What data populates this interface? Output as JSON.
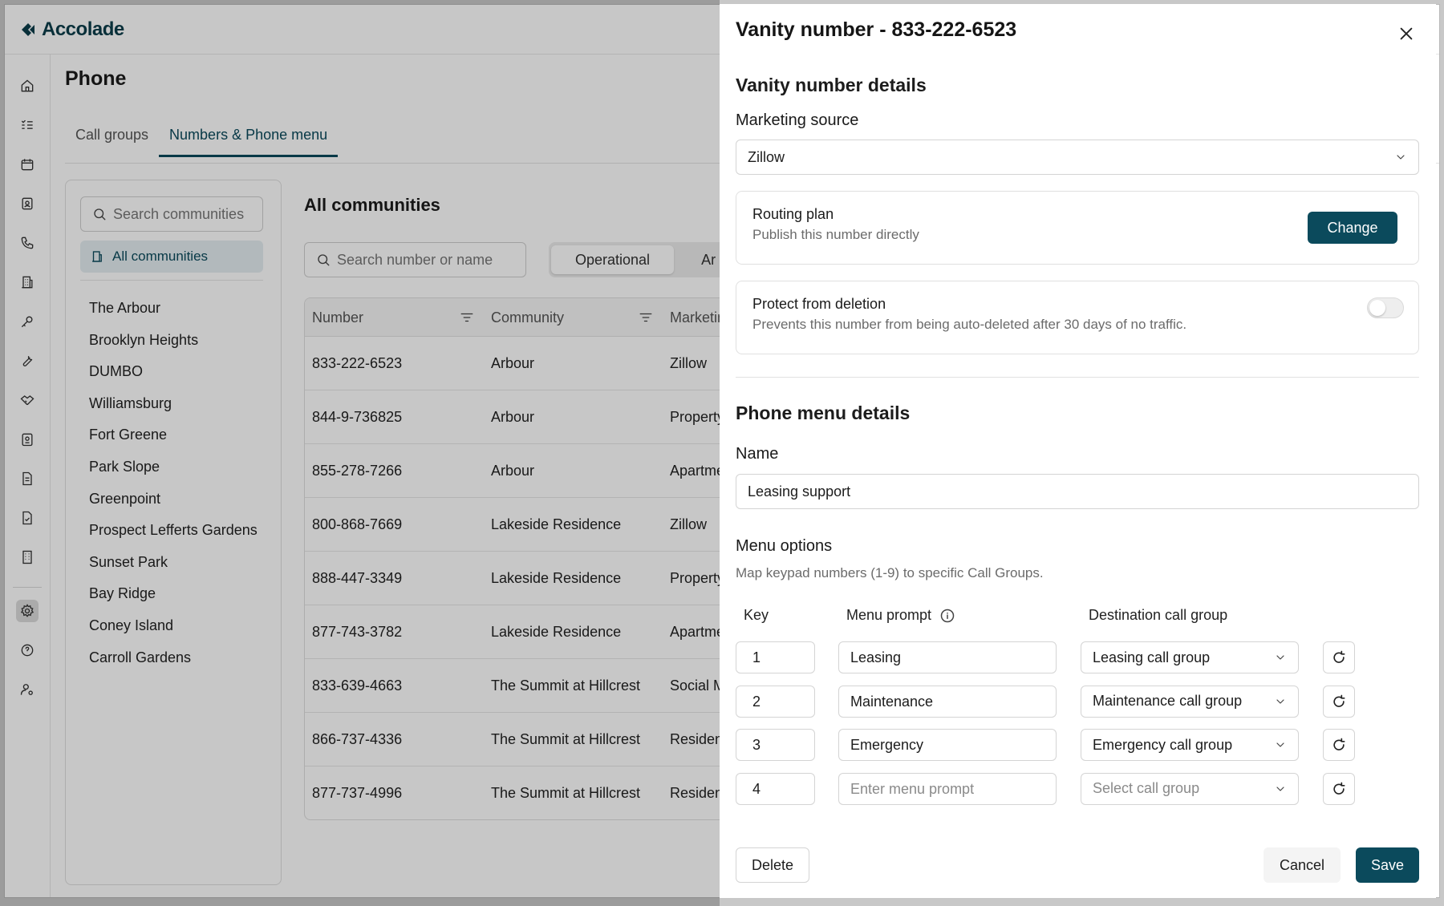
{
  "app": {
    "logo_text": "Accolade",
    "page_title": "Phone"
  },
  "rail_icons": [
    "home-icon",
    "checklist-icon",
    "calendar-icon",
    "contact-card-icon",
    "phone-icon",
    "buildings-icon",
    "key-icon",
    "wrench-icon",
    "handshake-icon",
    "badge-icon",
    "document-icon",
    "document-check-icon",
    "building-icon",
    "settings-icon",
    "help-icon",
    "user-settings-icon"
  ],
  "tabs": [
    {
      "label": "Call groups",
      "active": false
    },
    {
      "label": "Numbers & Phone menu",
      "active": true
    }
  ],
  "sidebar": {
    "search_placeholder": "Search communities",
    "all_label": "All communities",
    "communities": [
      "The Arbour",
      "Brooklyn Heights",
      "DUMBO",
      "Williamsburg",
      "Fort Greene",
      "Park Slope",
      "Greenpoint",
      "Prospect Lefferts Gardens",
      "Sunset Park",
      "Bay Ridge",
      "Coney Island",
      "Carroll Gardens"
    ]
  },
  "main": {
    "title": "All communities",
    "search_placeholder": "Search number or name",
    "segments": [
      "Operational",
      "Ar"
    ],
    "columns": [
      "Number",
      "Community",
      "Marketin"
    ],
    "rows": [
      {
        "number": "833-222-6523",
        "community": "Arbour",
        "marketing": "Zillow"
      },
      {
        "number": "844-9-736825",
        "community": "Arbour",
        "marketing": "Property"
      },
      {
        "number": "855-278-7266",
        "community": "Arbour",
        "marketing": "Apartmen"
      },
      {
        "number": "800-868-7669",
        "community": "Lakeside Residence",
        "marketing": "Zillow"
      },
      {
        "number": "888-447-3349",
        "community": "Lakeside Residence",
        "marketing": "Property"
      },
      {
        "number": "877-743-3782",
        "community": "Lakeside Residence",
        "marketing": "Apartmen"
      },
      {
        "number": "833-639-4663",
        "community": "The Summit at Hillcrest",
        "marketing": "Social Me"
      },
      {
        "number": "866-737-4336",
        "community": "The Summit at Hillcrest",
        "marketing": "Resident"
      },
      {
        "number": "877-737-4996",
        "community": "The Summit at Hillcrest",
        "marketing": "Resident"
      }
    ]
  },
  "drawer": {
    "title": "Vanity number - 833-222-6523",
    "details_heading": "Vanity number details",
    "marketing_source_label": "Marketing source",
    "marketing_source_value": "Zillow",
    "routing": {
      "title": "Routing plan",
      "subtitle": "Publish this number directly",
      "button": "Change"
    },
    "protect": {
      "title": "Protect from deletion",
      "subtitle": "Prevents this number from being auto-deleted after 30 days of no traffic.",
      "enabled": false
    },
    "phone_menu_heading": "Phone menu details",
    "name_label": "Name",
    "name_value": "Leasing support",
    "menu_options_label": "Menu options",
    "menu_options_help": "Map keypad numbers (1-9) to specific Call Groups.",
    "col_key": "Key",
    "col_prompt": "Menu prompt",
    "col_dest": "Destination call group",
    "options": [
      {
        "key": "1",
        "prompt": "Leasing",
        "prompt_placeholder": "",
        "dest": "Leasing call group"
      },
      {
        "key": "2",
        "prompt": "Maintenance",
        "prompt_placeholder": "",
        "dest": "Maintenance call group"
      },
      {
        "key": "3",
        "prompt": "Emergency",
        "prompt_placeholder": "",
        "dest": "Emergency call group"
      },
      {
        "key": "4",
        "prompt": "",
        "prompt_placeholder": "Enter menu prompt",
        "dest": "Select call group"
      }
    ],
    "footer": {
      "delete": "Delete",
      "cancel": "Cancel",
      "save": "Save"
    }
  },
  "colors": {
    "brand": "#0b4a5c",
    "accent_bg": "#e4eef1"
  }
}
